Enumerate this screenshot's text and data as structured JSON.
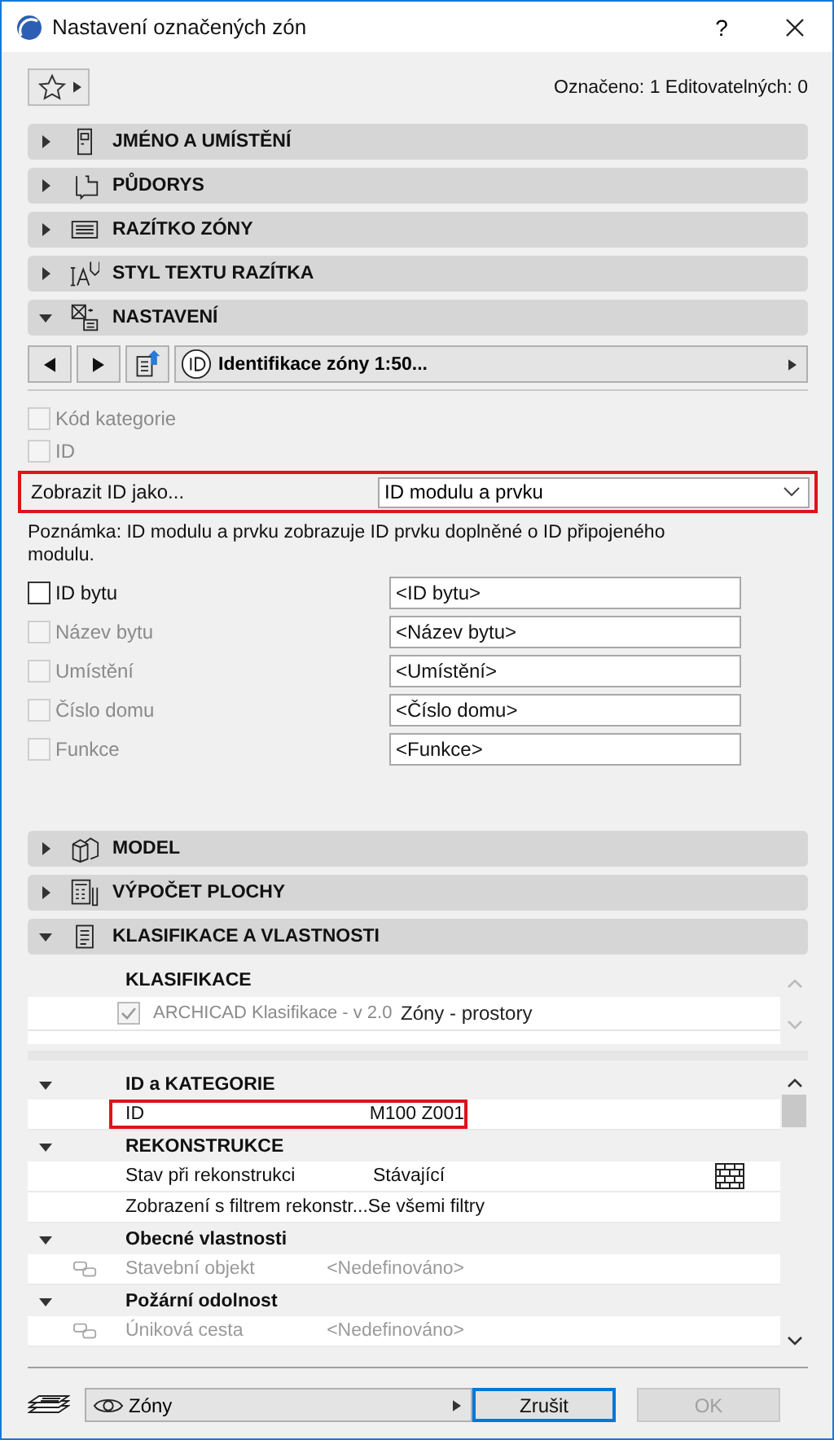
{
  "window": {
    "title": "Nastavení označených zón",
    "help": "?"
  },
  "selection_info": "Označeno: 1 Editovatelných: 0",
  "panels_top": [
    {
      "kind": "name",
      "label": "JMÉNO A UMÍSTĚNÍ",
      "expanded": false
    },
    {
      "kind": "floorplan",
      "label": "PŮDORYS",
      "expanded": false
    },
    {
      "kind": "stamp",
      "label": "RAZÍTKO ZÓNY",
      "expanded": false
    },
    {
      "kind": "textstyle",
      "label": "STYL TEXTU RAZÍTKA",
      "expanded": false
    },
    {
      "kind": "settings",
      "label": "NASTAVENÍ",
      "expanded": true
    }
  ],
  "settings": {
    "preset": "Identifikace zóny 1:50...",
    "id_options": [
      {
        "label": "Kód kategorie",
        "checked": false,
        "disabled": true
      },
      {
        "label": "ID",
        "checked": false,
        "disabled": true
      }
    ],
    "display_id": {
      "label": "Zobrazit ID jako...",
      "value": "ID modulu a prvku",
      "highlighted": true
    },
    "note": "Poznámka: ID modulu a prvku zobrazuje ID prvku doplněné o ID připojeného modulu.",
    "fields": [
      {
        "label": "ID bytu",
        "checked": false,
        "disabled": false,
        "value": "<ID bytu>"
      },
      {
        "label": "Název bytu",
        "checked": false,
        "disabled": true,
        "value": "<Název bytu>"
      },
      {
        "label": "Umístění",
        "checked": false,
        "disabled": true,
        "value": "<Umístění>"
      },
      {
        "label": "Číslo domu",
        "checked": false,
        "disabled": true,
        "value": "<Číslo domu>"
      },
      {
        "label": "Funkce",
        "checked": false,
        "disabled": true,
        "value": "<Funkce>"
      }
    ]
  },
  "panels_bottom": [
    {
      "kind": "model",
      "label": "MODEL",
      "expanded": false
    },
    {
      "kind": "area",
      "label": "VÝPOČET PLOCHY",
      "expanded": false
    },
    {
      "kind": "properties",
      "label": "KLASIFIKACE A VLASTNOSTI",
      "expanded": true
    }
  ],
  "classification": {
    "heading": "KLASIFIKACE",
    "rows": [
      {
        "system": "ARCHICAD Klasifikace - v 2.0",
        "value": "Zóny - prostory",
        "checked": true,
        "disabled": true
      }
    ]
  },
  "properties": [
    {
      "label": "ID a KATEGORIE",
      "expanded": true,
      "children": [
        {
          "kind": "plain",
          "name": "ID",
          "value": "M100 Z001",
          "highlighted": true,
          "disabled": false
        }
      ]
    },
    {
      "label": "REKONSTRUKCE",
      "expanded": true,
      "children": [
        {
          "kind": "brick",
          "name": "Stav při rekonstrukci",
          "value": "Stávající",
          "highlighted": false,
          "disabled": false
        },
        {
          "kind": "plain",
          "name": "Zobrazení s filtrem rekonstr...",
          "value": "Se všemi filtry",
          "highlighted": false,
          "disabled": false
        }
      ]
    },
    {
      "label": "Obecné vlastnosti",
      "expanded": true,
      "children": [
        {
          "kind": "linked",
          "name": "Stavební objekt",
          "value": "<Nedefinováno>",
          "highlighted": false,
          "disabled": true
        }
      ]
    },
    {
      "label": "Požární odolnost",
      "expanded": true,
      "children": [
        {
          "kind": "linked",
          "name": "Úniková cesta",
          "value": "<Nedefinováno>",
          "highlighted": false,
          "disabled": true
        }
      ]
    }
  ],
  "view": {
    "label": "Zóny"
  },
  "buttons": [
    {
      "label": "Zrušit",
      "default": true,
      "disabled": false
    },
    {
      "label": "OK",
      "default": false,
      "disabled": true
    }
  ]
}
